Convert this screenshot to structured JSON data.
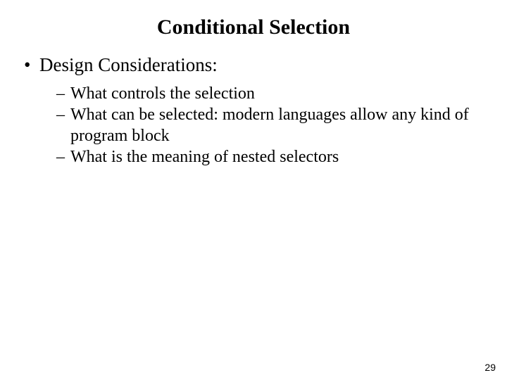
{
  "title": "Conditional Selection",
  "bullet_char": "•",
  "dash_char": "–",
  "l1_item": "Design Considerations:",
  "l2_items": [
    "What  controls the selection",
    "What can be selected: modern languages allow any kind of program block",
    "What is the meaning of nested selectors"
  ],
  "page_number": "29"
}
